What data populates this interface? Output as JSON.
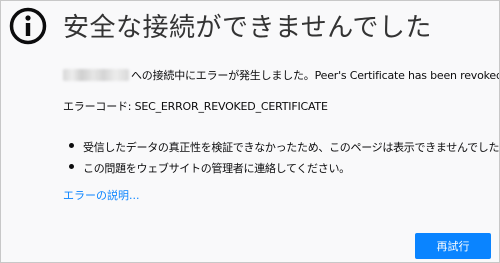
{
  "page": {
    "title": "安全な接続ができませんでした",
    "error_prefix": "への接続中にエラーが発生しました。",
    "error_detail": "Peer's Certificate has been revoked.",
    "error_code_label": "エラーコード:",
    "error_code": "SEC_ERROR_REVOKED_CERTIFICATE",
    "bullets": [
      "受信したデータの真正性を検証できなかったため、このページは表示できませんでした。",
      "この問題をウェブサイトの管理者に連絡してください。"
    ],
    "learn_more": "エラーの説明...",
    "retry_label": "再試行"
  },
  "colors": {
    "background": "#f9f9fa",
    "text": "#0c0c0d",
    "title": "#333333",
    "accent": "#0a84ff"
  },
  "icons": {
    "header": "info-icon"
  }
}
